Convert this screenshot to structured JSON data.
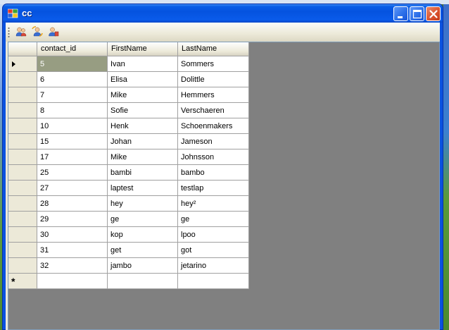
{
  "window": {
    "title": "cc"
  },
  "toolbar": {
    "buttons": [
      {
        "icon": "users-icon"
      },
      {
        "icon": "user-refresh-icon"
      },
      {
        "icon": "user-edit-icon"
      }
    ]
  },
  "grid": {
    "columns": [
      "contact_id",
      "FirstName",
      "LastName"
    ],
    "rows": [
      [
        "5",
        "Ivan",
        "Sommers"
      ],
      [
        "6",
        "Elisa",
        "Dolittle"
      ],
      [
        "7",
        "Mike",
        "Hemmers"
      ],
      [
        "8",
        "Sofie",
        "Verschaeren"
      ],
      [
        "10",
        "Henk",
        "Schoenmakers"
      ],
      [
        "15",
        "Johan",
        "Jameson"
      ],
      [
        "17",
        "Mike",
        "Johnsson"
      ],
      [
        "25",
        "bambi",
        "bambo"
      ],
      [
        "27",
        "laptest",
        "testlap"
      ],
      [
        "28",
        "hey",
        "hey²"
      ],
      [
        "29",
        "ge",
        "ge"
      ],
      [
        "30",
        "kop",
        "lpoo"
      ],
      [
        "31",
        "get",
        "got"
      ],
      [
        "32",
        "jambo",
        "jetarino"
      ]
    ],
    "new_row_marker": "*",
    "selected_row": 0
  },
  "colors": {
    "titlebar": "#0553df",
    "selected_cell": "#979d82",
    "grid_background": "#808080"
  }
}
